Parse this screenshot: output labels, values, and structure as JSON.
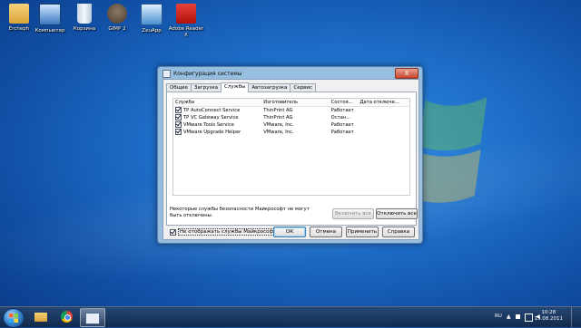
{
  "desktop": {
    "icons": [
      {
        "label": "Ercheph"
      },
      {
        "label": "Компьютер"
      },
      {
        "label": "Корзина"
      },
      {
        "label": "GIMP 2"
      },
      {
        "label": "ZeuApp"
      },
      {
        "label": "Adobe Reader X"
      }
    ]
  },
  "dialog": {
    "title": "Конфигурация системы",
    "close_label": "X",
    "tabs": [
      "Общие",
      "Загрузка",
      "Службы",
      "Автозагрузка",
      "Сервис"
    ],
    "active_tab": "Службы",
    "columns": [
      "Служба",
      "Изготовитель",
      "Состоя...",
      "Дата отключе..."
    ],
    "services": [
      {
        "name": "TP AutoConnect Service",
        "vendor": "ThinPrint AG",
        "status": "Работает",
        "checked": true
      },
      {
        "name": "TP VC Gateway Service",
        "vendor": "ThinPrint AG",
        "status": "Остан...",
        "checked": true
      },
      {
        "name": "VMware Tools Service",
        "vendor": "VMware, Inc.",
        "status": "Работает",
        "checked": true
      },
      {
        "name": "VMware Upgrade Helper",
        "vendor": "VMware, Inc.",
        "status": "Работает",
        "checked": true
      }
    ],
    "note": "Некоторые службы безопасности Майкрософт не могут быть отключены.",
    "enable_all": "Включить все",
    "disable_all": "Отключить все",
    "hide_ms_label": "Не отображать службы Майкрософт",
    "hide_ms_checked": true,
    "ok": "ОК",
    "cancel": "Отмена",
    "apply": "Применить",
    "help": "Справка"
  },
  "taskbar": {
    "language": "RU",
    "time": "10:28",
    "date": "19.08.2011"
  }
}
